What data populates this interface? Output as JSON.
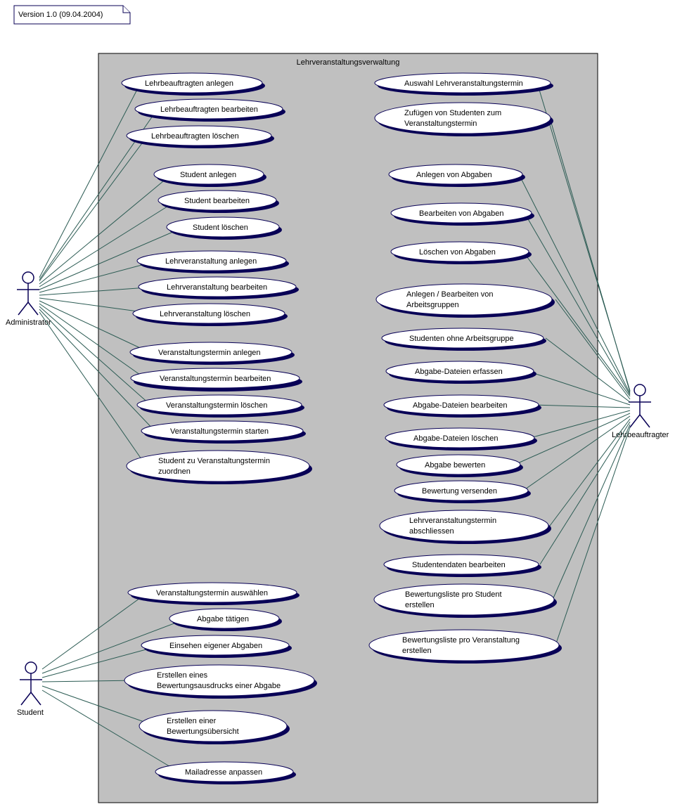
{
  "note": "Version 1.0 (09.04.2004)",
  "system_title": "Lehrveranstaltungsverwaltung",
  "actors": {
    "admin": "Administrator",
    "student": "Student",
    "lehr": "Lehrbeauftragter"
  },
  "usecases": {
    "l_anlegen": "Lehrbeauftragten anlegen",
    "l_bearbeiten": "Lehrbeauftragten bearbeiten",
    "l_loeschen": "Lehrbeauftragten löschen",
    "s_anlegen": "Student anlegen",
    "s_bearbeiten": "Student bearbeiten",
    "s_loeschen": "Student löschen",
    "lv_anlegen": "Lehrveranstaltung anlegen",
    "lv_bearbeiten": "Lehrveranstaltung bearbeiten",
    "lv_loeschen": "Lehrveranstaltung löschen",
    "vt_anlegen": "Veranstaltungstermin anlegen",
    "vt_bearbeiten": "Veranstaltungstermin bearbeiten",
    "vt_loeschen": "Veranstaltungstermin löschen",
    "vt_starten": "Veranstaltungstermin starten",
    "s_zuordnen_1": "Student zu Veranstaltungstermin",
    "s_zuordnen_2": "zuordnen",
    "vt_auswahl": "Veranstaltungstermin auswählen",
    "abg_taetigen": "Abgabe tätigen",
    "eig_abg": "Einsehen eigener Abgaben",
    "bew_ausdruck_1": "Erstellen eines",
    "bew_ausdruck_2": "Bewertungsausdrucks einer Abgabe",
    "bew_ueb_1": "Erstellen einer",
    "bew_ueb_2": "Bewertungsübersicht",
    "mail": "Mailadresse anpassen",
    "r_auswahl_lvt": "Auswahl Lehrveranstaltungstermin",
    "r_zufuegen_1": "Zufügen von Studenten zum",
    "r_zufuegen_2": "Veranstaltungstermin",
    "r_abg_anlegen": "Anlegen von Abgaben",
    "r_abg_bearb": "Bearbeiten von Abgaben",
    "r_abg_loesch": "Löschen von Abgaben",
    "r_ag_1": "Anlegen / Bearbeiten von",
    "r_ag_2": "Arbeitsgruppen",
    "r_s_ohne_ag": "Studenten ohne Arbeitsgruppe",
    "r_ad_erf": "Abgabe-Dateien erfassen",
    "r_ad_bearb": "Abgabe-Dateien bearbeiten",
    "r_ad_loesch": "Abgabe-Dateien löschen",
    "r_abg_bew": "Abgabe bewerten",
    "r_bew_vers": "Bewertung versenden",
    "r_lvt_abs_1": "Lehrveranstaltungstermin",
    "r_lvt_abs_2": "abschliessen",
    "r_sd_bearb": "Studentendaten bearbeiten",
    "r_bl_stud_1": "Bewertungsliste pro Student",
    "r_bl_stud_2": "erstellen",
    "r_bl_ver_1": "Bewertungsliste pro Veranstaltung",
    "r_bl_ver_2": "erstellen"
  }
}
